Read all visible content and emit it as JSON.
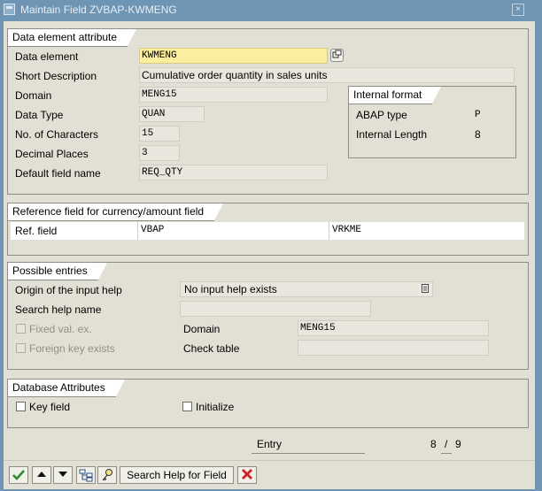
{
  "window": {
    "title": "Maintain Field ZVBAP-KWMENG",
    "close_glyph": "×"
  },
  "data_element_attribute": {
    "header": "Data element attribute",
    "rows": {
      "data_element": {
        "label": "Data element",
        "value": "KWMENG"
      },
      "short_description": {
        "label": "Short Description",
        "value": "Cumulative order quantity in sales units"
      },
      "domain": {
        "label": "Domain",
        "value": "MENG15"
      },
      "data_type": {
        "label": "Data Type",
        "value": "QUAN"
      },
      "no_of_characters": {
        "label": "No. of Characters",
        "value": "15"
      },
      "decimal_places": {
        "label": "Decimal Places",
        "value": "3"
      },
      "default_field_name": {
        "label": "Default field name",
        "value": "REQ_QTY"
      }
    },
    "internal_format": {
      "header": "Internal format",
      "abap_type": {
        "label": "ABAP type",
        "value": "P"
      },
      "internal_length": {
        "label": "Internal Length",
        "value": "8"
      }
    }
  },
  "reference_field": {
    "header": "Reference field for currency/amount field",
    "label": "Ref. field",
    "table": "VBAP",
    "field": "VRKME"
  },
  "possible_entries": {
    "header": "Possible entries",
    "origin_label": "Origin of the input help",
    "origin_value": "No input help exists",
    "search_help_label": "Search help name",
    "search_help_value": "",
    "fixed_val_label": "Fixed val. ex.",
    "foreign_key_label": "Foreign key exists",
    "domain_label": "Domain",
    "domain_value": "MENG15",
    "check_table_label": "Check table",
    "check_table_value": ""
  },
  "database_attributes": {
    "header": "Database Attributes",
    "key_field_label": "Key field",
    "key_field_checked": false,
    "initialize_label": "Initialize",
    "initialize_checked": false
  },
  "entry_indicator": {
    "label": "Entry",
    "current": "8",
    "separator": "/",
    "total": "9"
  },
  "toolbar": {
    "icons": [
      "checkmark-icon",
      "arrow-up-icon",
      "arrow-down-icon",
      "hierarchy-icon",
      "key-icon",
      "cancel-icon"
    ],
    "search_help_label": "Search Help for Field"
  },
  "colors": {
    "title_bar": "#6f95b4",
    "panel": "#e2e0d4",
    "highlight_field": "#fbee9e",
    "confirm": "#2e8b2e",
    "cancel": "#d42020"
  }
}
